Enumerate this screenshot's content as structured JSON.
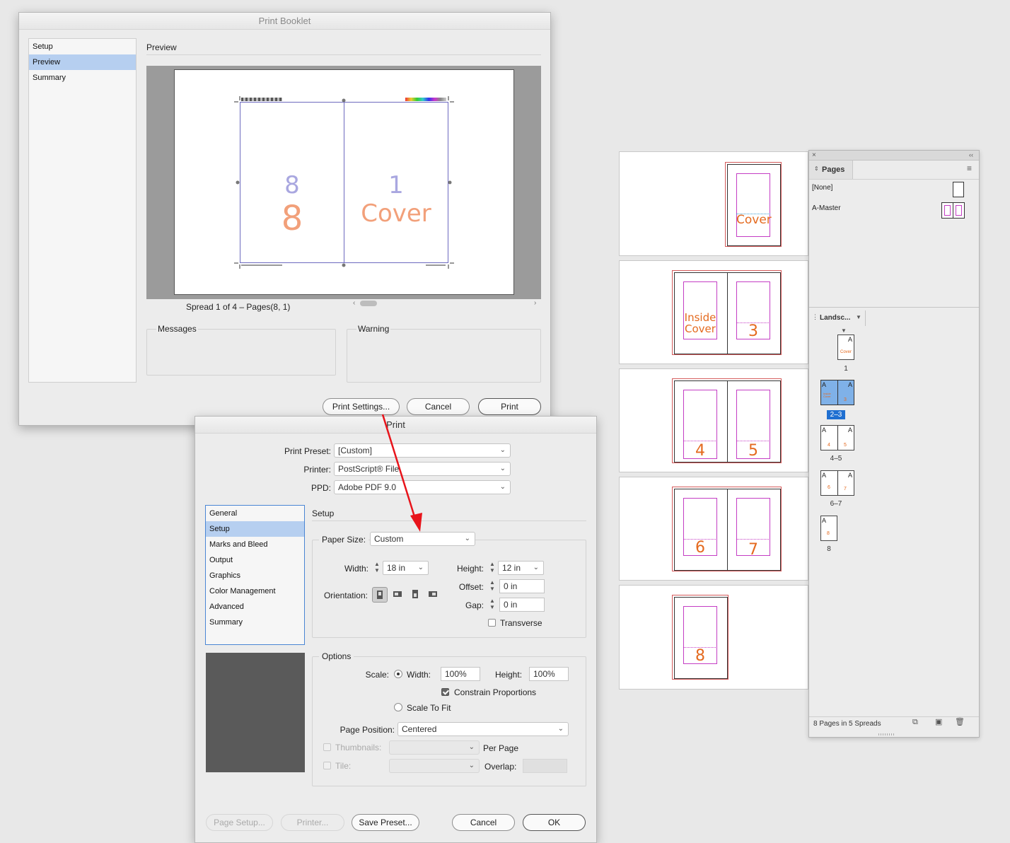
{
  "booklet": {
    "title": "Print Booklet",
    "nav": [
      "Setup",
      "Preview",
      "Summary"
    ],
    "nav_selected": 1,
    "section_title": "Preview",
    "preview_left_small": "8",
    "preview_left_big": "8",
    "preview_right_small": "1",
    "preview_right_big": "Cover",
    "spread_caption": "Spread 1 of 4 – Pages(8, 1)",
    "messages_label": "Messages",
    "warning_label": "Warning",
    "print_settings_btn": "Print Settings...",
    "cancel_btn": "Cancel",
    "print_btn": "Print"
  },
  "print": {
    "title": "Print",
    "preset_label": "Print Preset:",
    "preset_value": "[Custom]",
    "printer_label": "Printer:",
    "printer_value": "PostScript® File",
    "ppd_label": "PPD:",
    "ppd_value": "Adobe PDF 9.0",
    "nav": [
      "General",
      "Setup",
      "Marks and Bleed",
      "Output",
      "Graphics",
      "Color Management",
      "Advanced",
      "Summary"
    ],
    "nav_selected": 1,
    "section_title": "Setup",
    "paper_size_label": "Paper Size:",
    "paper_size_value": "Custom",
    "width_label": "Width:",
    "width_value": "18 in",
    "height_label": "Height:",
    "height_value": "12 in",
    "orientation_label": "Orientation:",
    "offset_label": "Offset:",
    "offset_value": "0 in",
    "gap_label": "Gap:",
    "gap_value": "0 in",
    "transverse_label": "Transverse",
    "options_label": "Options",
    "scale_label": "Scale:",
    "scale_width_label": "Width:",
    "scale_width_value": "100%",
    "scale_height_label": "Height:",
    "scale_height_value": "100%",
    "constrain_label": "Constrain Proportions",
    "scale_to_fit_label": "Scale To Fit",
    "page_position_label": "Page Position:",
    "page_position_value": "Centered",
    "thumbnails_label": "Thumbnails:",
    "per_page_label": "Per Page",
    "tile_label": "Tile:",
    "overlap_label": "Overlap:",
    "page_setup_btn": "Page Setup...",
    "printer_btn": "Printer...",
    "save_preset_btn": "Save Preset...",
    "cancel_btn": "Cancel",
    "ok_btn": "OK"
  },
  "spreads": {
    "cover": "Cover",
    "inside_cover_1": "Inside",
    "inside_cover_2": "Cover",
    "p3": "3",
    "p4": "4",
    "p5": "5",
    "p6": "6",
    "p7": "7",
    "p8": "8"
  },
  "pages_panel": {
    "tab": "Pages",
    "none_master": "[None]",
    "a_master": "A-Master",
    "view_menu": "Landsc...",
    "thumb_labels": [
      "1",
      "2–3",
      "4–5",
      "6–7",
      "8"
    ],
    "selected_spread": "2–3",
    "footer": "8 Pages in 5 Spreads",
    "master_letter": "A",
    "thumb_cover": "Cover",
    "thumb_inside": "Inside Cover",
    "thumb_nums": [
      "3",
      "4",
      "5",
      "6",
      "7",
      "8"
    ]
  },
  "colors": {
    "accent_orange": "#e46a1f",
    "preview_orange": "#f2a07a",
    "preview_purple": "#a9a7e0",
    "selection_blue": "#b6cff0",
    "arrow_red": "#e8141b"
  }
}
